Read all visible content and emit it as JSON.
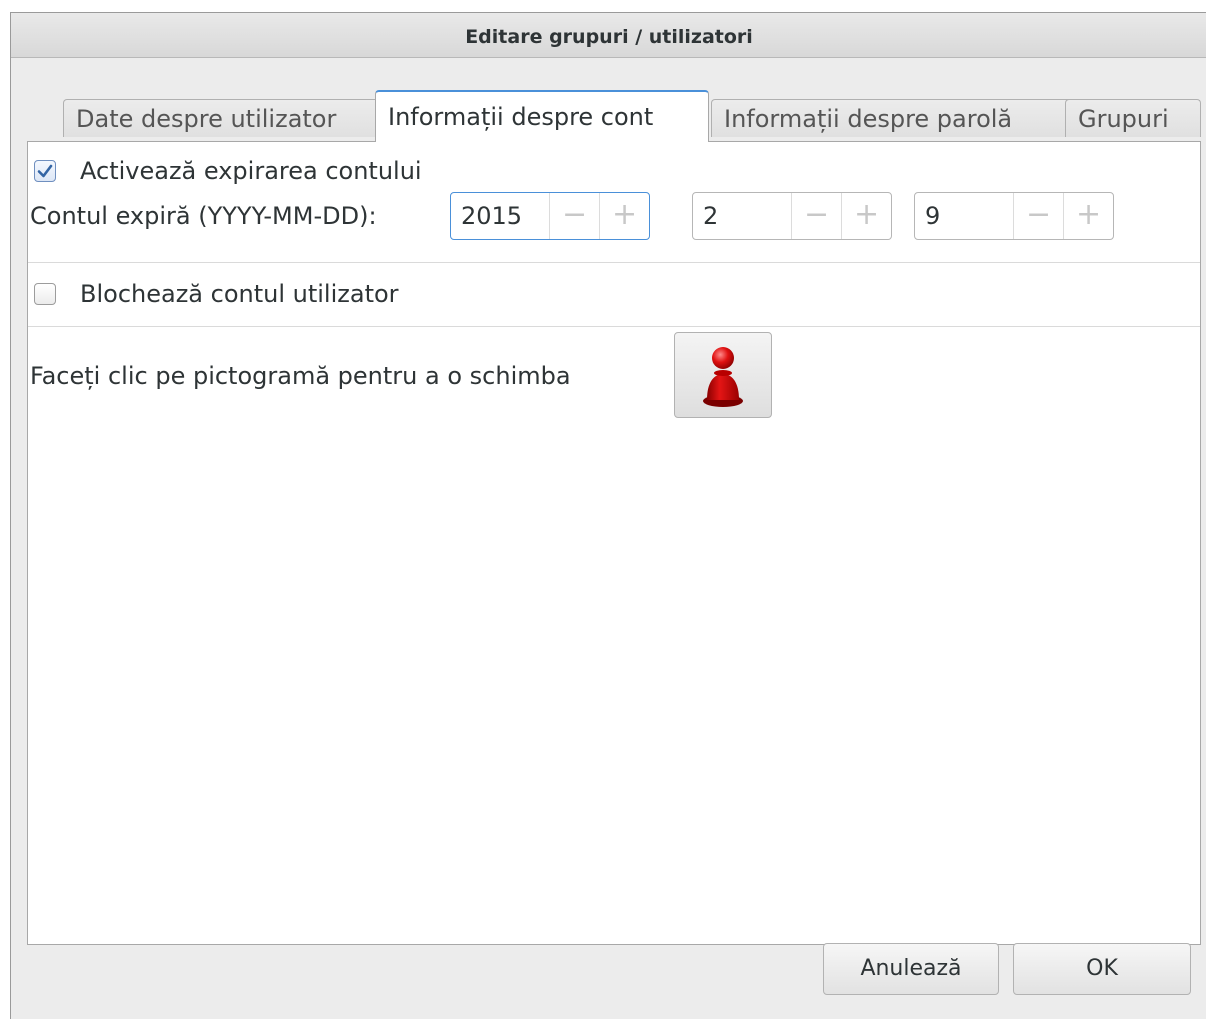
{
  "window": {
    "title": "Editare grupuri / utilizatori"
  },
  "tabs": [
    {
      "label": "Date despre utilizator",
      "active": false
    },
    {
      "label": "Informații despre cont",
      "active": true
    },
    {
      "label": "Informații despre parolă",
      "active": false
    },
    {
      "label": "Grupuri",
      "active": false
    }
  ],
  "account": {
    "enable_expiration": {
      "label": "Activează expirarea contului",
      "checked": true
    },
    "expires_label": "Contul expiră (YYYY-MM-DD):",
    "year": "2015",
    "month": "2",
    "day": "9",
    "minus": "−",
    "plus": "+",
    "lock_account": {
      "label": "Blochează contul utilizator",
      "checked": false
    },
    "icon_hint": "Faceți clic pe pictogramă pentru a o schimba",
    "user_icon": "user-avatar-icon"
  },
  "buttons": {
    "cancel": "Anulează",
    "ok": "OK"
  },
  "colors": {
    "accent": "#4a90d9",
    "avatar_red": "#d00000"
  }
}
